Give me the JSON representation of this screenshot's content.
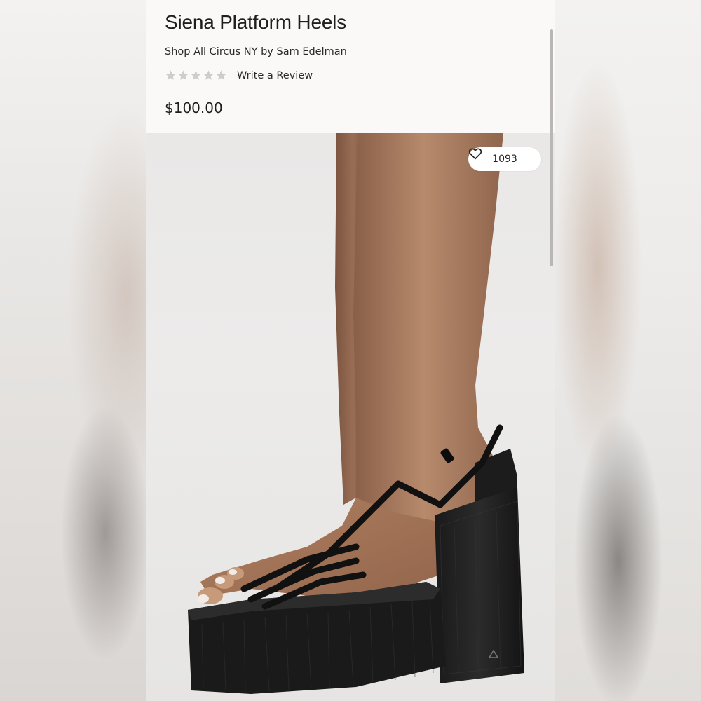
{
  "product": {
    "title": "Siena Platform Heels",
    "shop_link": "Shop All Circus NY by Sam Edelman",
    "rating_stars": 0,
    "rating_max": 5,
    "review_link": "Write a Review",
    "price": "$100.00"
  },
  "image": {
    "like_count": "1093",
    "like_icon": "heart-outline-icon"
  },
  "colors": {
    "star_empty": "#cfcccc",
    "text": "#1f1f1f"
  }
}
